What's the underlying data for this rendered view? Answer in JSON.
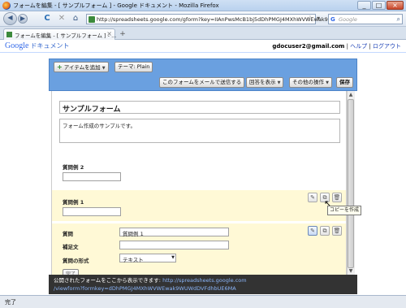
{
  "window": {
    "title": "フォームを編集 - [ サンプルフォーム ] - Google ドキュメント - Mozilla Firefox",
    "min": "_",
    "max": "□",
    "close": "×"
  },
  "nav": {
    "back": "◀",
    "forward": "▶",
    "reload": "C",
    "stop": "✕",
    "home": "⌂",
    "url": "http://spreadsheets.google.com/gform?key=IIAnPwsMcB1bj5dDhPMGJ4MXhWVWEwak9",
    "search_brand": "G",
    "search_placeholder": "Google"
  },
  "tabs": [
    {
      "label": "フォームを編集 - [ サンプルフォーム ] - ...",
      "close": "×"
    }
  ],
  "new_tab": "+",
  "header": {
    "logo": "Google",
    "product": "ドキュメント",
    "user": "gdocuser2@gmail.com",
    "sep": "|",
    "help": "ヘルプ",
    "logout": "ログアウト"
  },
  "toolbar": {
    "add_item": "アイテムを追加",
    "theme": "テーマ: Plain",
    "email_form": "このフォームをメールで送信する",
    "show_responses": "回答を表示",
    "more_actions": "その他の操作",
    "save": "保存"
  },
  "form": {
    "title": "サンプルフォーム",
    "description": "フォーム作成のサンプルです。"
  },
  "questions": [
    {
      "label": "質問例 2"
    },
    {
      "label": "質問例 1"
    }
  ],
  "editor": {
    "question_label": "質問",
    "question_value": "質問例 1",
    "help_label": "補足文",
    "help_value": "",
    "type_label": "質問の形式",
    "type_value": "テキスト",
    "done_partial": "完了"
  },
  "icons": {
    "edit": "✎",
    "copy": "⧉",
    "delete": "🗑"
  },
  "tooltip": "コピーを作成",
  "publish": {
    "text": "公開されたフォームをここから表示できます:",
    "link1": "http://spreadsheets.google.com",
    "link2": "/viewform?formkey=dDhPMGJ4MXhWVWEwak9WUWdDVFdhbUE6MA"
  },
  "status": "完了"
}
